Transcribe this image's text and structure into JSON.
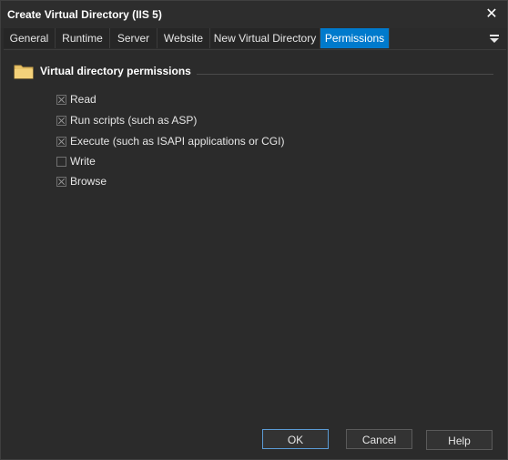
{
  "window": {
    "title": "Create Virtual Directory (IIS 5)"
  },
  "tabs": [
    {
      "label": "General"
    },
    {
      "label": "Runtime"
    },
    {
      "label": "Server"
    },
    {
      "label": "Website"
    },
    {
      "label": "New Virtual Directory"
    },
    {
      "label": "Permissions"
    }
  ],
  "active_tab": "Permissions",
  "group": {
    "title": "Virtual directory permissions",
    "icon": "folder-icon"
  },
  "checkboxes": [
    {
      "label": "Read",
      "checked": true
    },
    {
      "label": "Run scripts (such as ASP)",
      "checked": true
    },
    {
      "label": "Execute (such as ISAPI applications or CGI)",
      "checked": true
    },
    {
      "label": "Write",
      "checked": false
    },
    {
      "label": "Browse",
      "checked": true
    }
  ],
  "buttons": {
    "ok": "OK",
    "cancel": "Cancel",
    "help": "Help"
  },
  "colors": {
    "accent": "#007acc",
    "background": "#2b2b2b"
  }
}
